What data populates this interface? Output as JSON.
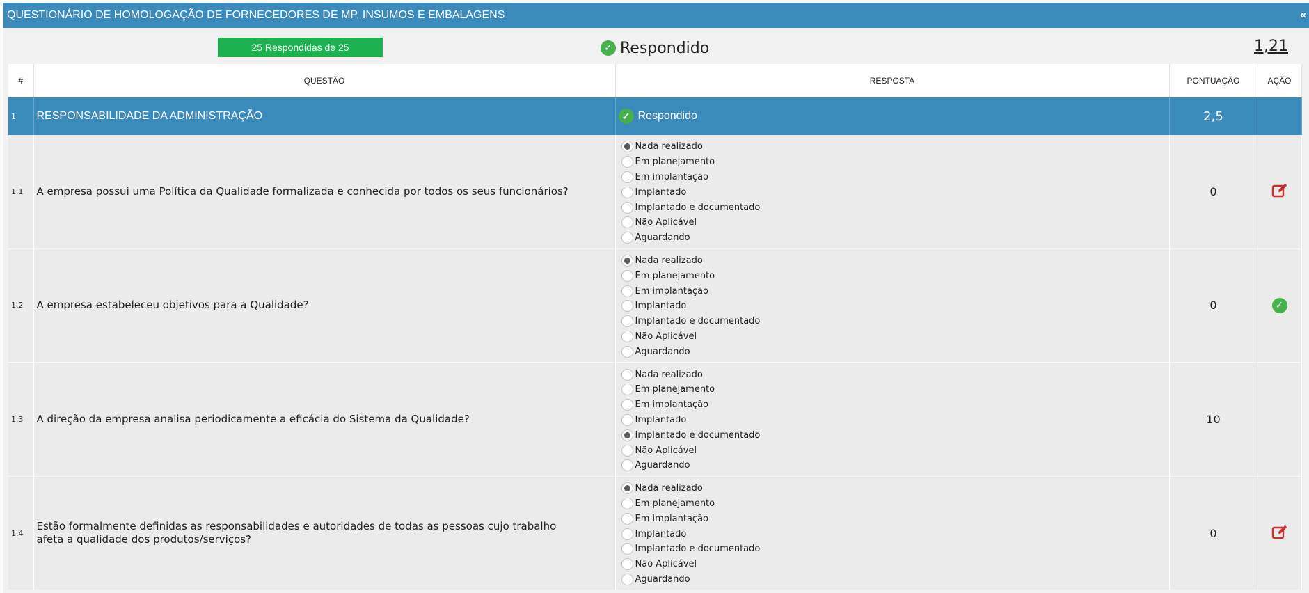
{
  "title": "QUESTIONÁRIO DE HOMOLOGAÇÃO DE FORNECEDORES DE MP, INSUMOS E EMBALAGENS",
  "collapse_icon": "«",
  "summary": {
    "progress": "25 Respondidas de 25",
    "status": "Respondido",
    "score_total": "1,21"
  },
  "headers": {
    "num": "#",
    "question": "QUESTÃO",
    "answer": "RESPOSTA",
    "score": "PONTUAÇÃO",
    "action": "AÇÃO"
  },
  "section": {
    "num": "1",
    "title": "RESPONSABILIDADE DA ADMINISTRAÇÃO",
    "status": "Respondido",
    "score": "2,5"
  },
  "options": [
    "Nada realizado",
    "Em planejamento",
    "Em implantação",
    "Implantado",
    "Implantado e documentado",
    "Não Aplicável",
    "Aguardando"
  ],
  "items": [
    {
      "num": "1.1",
      "question": "A empresa possui uma Política da Qualidade formalizada e conhecida por todos os seus funcionários?",
      "selected": 0,
      "score": "0",
      "action": "edit-icon"
    },
    {
      "num": "1.2",
      "question": "A empresa estabeleceu objetivos para a Qualidade?",
      "selected": 0,
      "score": "0",
      "action": "check-icon"
    },
    {
      "num": "1.3",
      "question": "A direção da empresa analisa periodicamente a eficácia do Sistema da Qualidade?",
      "selected": 4,
      "score": "10",
      "action": ""
    },
    {
      "num": "1.4",
      "question": "Estão formalmente definidas as responsabilidades e autoridades de todas as pessoas cujo trabalho afeta a qualidade dos produtos/serviços?",
      "selected": 0,
      "score": "0",
      "action": "edit-icon"
    }
  ],
  "colors": {
    "header_blue": "#3a8bbb",
    "progress_green": "#1bb24f",
    "check_green": "#46b04a",
    "edit_red": "#c9302c"
  }
}
